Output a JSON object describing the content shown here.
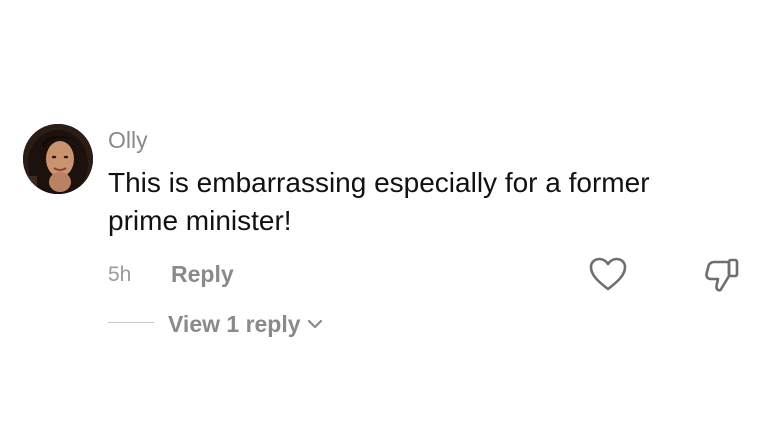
{
  "comment": {
    "username": "Olly",
    "text": "This is embarrassing especially for a former prime minister!",
    "timestamp": "5h",
    "reply_label": "Reply",
    "view_replies_label": "View 1 reply",
    "icons": {
      "avatar": "profile-photo",
      "like": "heart-outline-icon",
      "dislike": "thumbs-down-outline-icon",
      "expand": "chevron-down-icon"
    }
  }
}
